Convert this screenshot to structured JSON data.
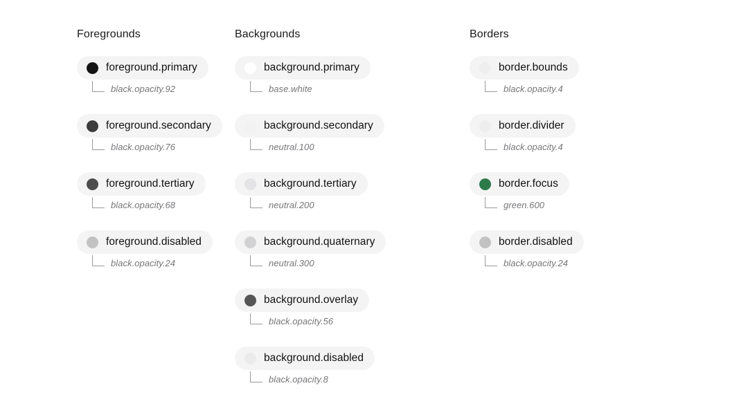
{
  "page": {
    "background": "#ffffff",
    "pill_background": "#f4f4f5",
    "title_color": "#1a1a1a",
    "reference_color": "#76767a",
    "connector_color": "#9a9a9a"
  },
  "columns": [
    {
      "id": "foregrounds",
      "title": "Foregrounds",
      "tokens": [
        {
          "name": "foreground.primary",
          "reference": "black.opacity.92",
          "swatch": "#141414"
        },
        {
          "name": "foreground.secondary",
          "reference": "black.opacity.76",
          "swatch": "#3d3d3d"
        },
        {
          "name": "foreground.tertiary",
          "reference": "black.opacity.68",
          "swatch": "#4d4d4d"
        },
        {
          "name": "foreground.disabled",
          "reference": "black.opacity.24",
          "swatch": "#c2c2c2"
        }
      ]
    },
    {
      "id": "backgrounds",
      "title": "Backgrounds",
      "tokens": [
        {
          "name": "background.primary",
          "reference": "base.white",
          "swatch": "#ffffff"
        },
        {
          "name": "background.secondary",
          "reference": "neutral.100",
          "swatch": "#f2f2f3"
        },
        {
          "name": "background.tertiary",
          "reference": "neutral.200",
          "swatch": "#e4e4e6"
        },
        {
          "name": "background.quaternary",
          "reference": "neutral.300",
          "swatch": "#d2d2d4"
        },
        {
          "name": "background.overlay",
          "reference": "black.opacity.56",
          "swatch": "#565656"
        },
        {
          "name": "background.disabled",
          "reference": "black.opacity.8",
          "swatch": "#ebebec"
        }
      ]
    },
    {
      "id": "borders",
      "title": "Borders",
      "tokens": [
        {
          "name": "border.bounds",
          "reference": "black.opacity.4",
          "swatch": "#eeeeef"
        },
        {
          "name": "border.divider",
          "reference": "black.opacity.4",
          "swatch": "#eeeeef"
        },
        {
          "name": "border.focus",
          "reference": "green.600",
          "swatch": "#2e7a4a"
        },
        {
          "name": "border.disabled",
          "reference": "black.opacity.24",
          "swatch": "#c2c2c2"
        }
      ]
    }
  ]
}
